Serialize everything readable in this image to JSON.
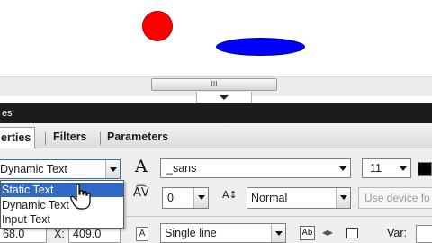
{
  "stage": {
    "grip_label": "III"
  },
  "panel": {
    "title": "es"
  },
  "tabs": {
    "properties": "erties",
    "filters": "Filters",
    "parameters": "Parameters"
  },
  "text_type": {
    "selected": "Dynamic Text",
    "options": [
      "Static Text",
      "Dynamic Text",
      "Input Text"
    ],
    "highlighted": "Static Text"
  },
  "font": {
    "family": "_sans",
    "size": "11"
  },
  "spacing": {
    "letter_spacing": "0",
    "position": "Normal"
  },
  "device_fonts_label": "Use device fo",
  "line_type": "Single line",
  "var_label": "Var:",
  "geometry_readout": {
    "w_value": "68.0",
    "x_label": "X:",
    "x_value": "409.0"
  },
  "colors": {
    "stage_bg": "#ffffff",
    "circle": "#ff0000",
    "ellipse": "#0000ff",
    "title_bar": "#1c1c1c",
    "selection": "#3169c6",
    "text_color_chip": "#000000"
  }
}
